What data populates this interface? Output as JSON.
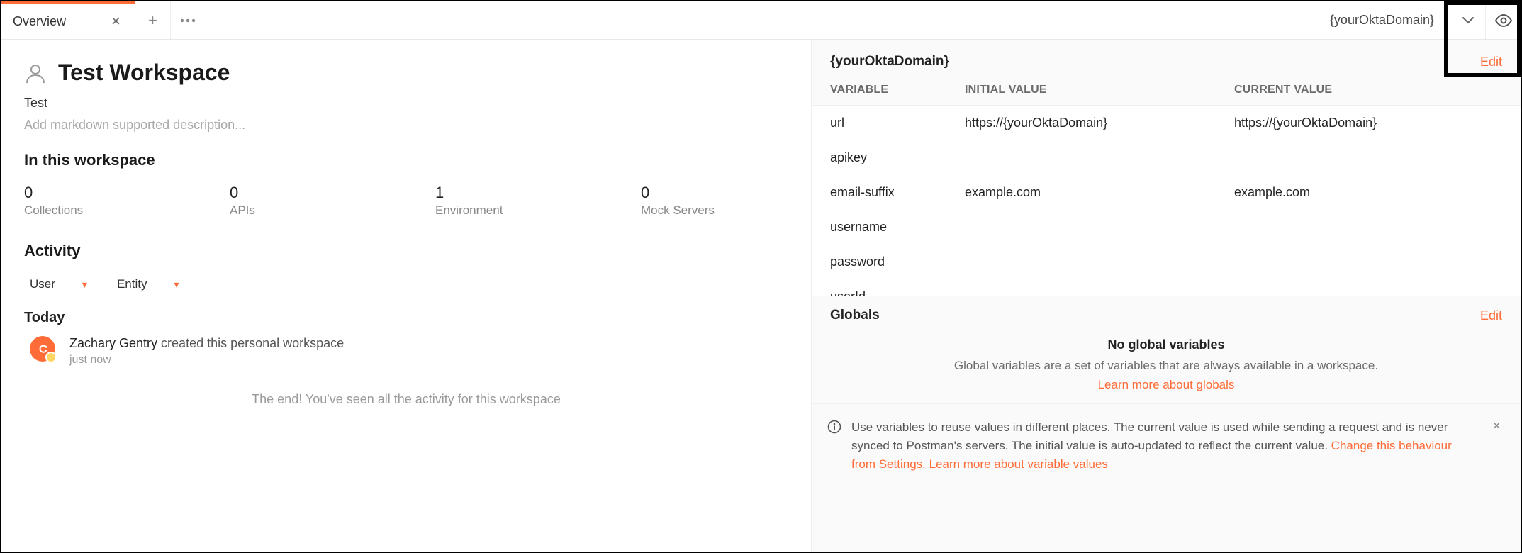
{
  "tab": {
    "label": "Overview"
  },
  "env_selector": "{yourOktaDomain}",
  "workspace": {
    "title": "Test Workspace",
    "summary": "Test",
    "desc_placeholder": "Add markdown supported description..."
  },
  "in_ws_heading": "In this workspace",
  "stats": [
    {
      "count": "0",
      "label": "Collections"
    },
    {
      "count": "0",
      "label": "APIs"
    },
    {
      "count": "1",
      "label": "Environment"
    },
    {
      "count": "0",
      "label": "Mock Servers"
    }
  ],
  "activity": {
    "heading": "Activity",
    "filters": {
      "user": "User",
      "entity": "Entity"
    },
    "day": "Today",
    "item": {
      "who": "Zachary Gentry",
      "what": " created this personal workspace",
      "time": "just now"
    },
    "end": "The end! You've seen all the activity for this workspace"
  },
  "env_panel": {
    "name": "{yourOktaDomain}",
    "edit": "Edit",
    "columns": {
      "var": "VARIABLE",
      "init": "INITIAL VALUE",
      "cur": "CURRENT VALUE"
    },
    "rows": [
      {
        "var": "url",
        "init": "https://{yourOktaDomain}",
        "cur": "https://{yourOktaDomain}"
      },
      {
        "var": "apikey",
        "init": "",
        "cur": ""
      },
      {
        "var": "email-suffix",
        "init": "example.com",
        "cur": "example.com"
      },
      {
        "var": "username",
        "init": "",
        "cur": ""
      },
      {
        "var": "password",
        "init": "",
        "cur": ""
      },
      {
        "var": "userId",
        "init": "",
        "cur": ""
      }
    ],
    "globals_title": "Globals",
    "globals_edit": "Edit",
    "no_globals": "No global variables",
    "globals_desc": "Global variables are a set of variables that are always available in a workspace.",
    "globals_learn": "Learn more about globals",
    "info_text_1": "Use variables to reuse values in different places. The current value is used while sending a request and is never synced to Postman's servers. The initial value is auto-updated to reflect the current value. ",
    "info_link_1": "Change this behaviour from Settings.",
    "info_link_2": "Learn more about variable values"
  }
}
